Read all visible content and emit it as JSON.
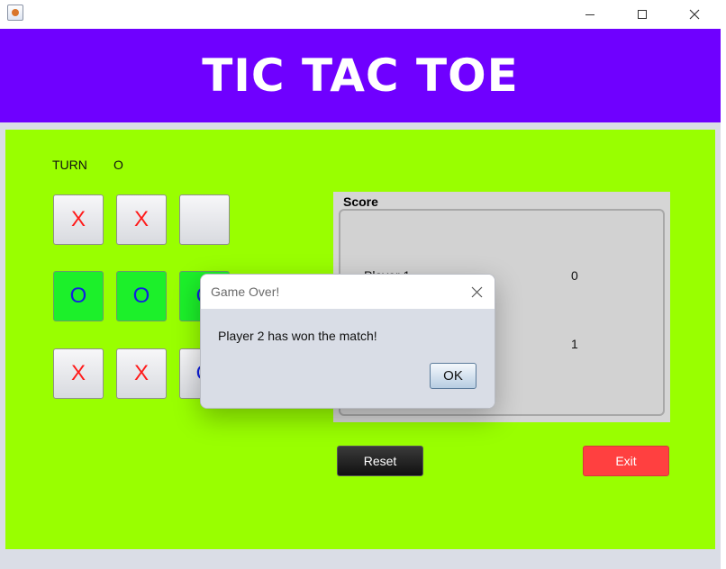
{
  "window": {
    "icon": "java-cup-icon",
    "controls": {
      "minimize": "minimize-icon",
      "maximize": "maximize-icon",
      "close": "close-icon"
    }
  },
  "header": {
    "title": "TIC TAC TOE",
    "background": "#6f00ff"
  },
  "game": {
    "background": "#99ff00",
    "turn_label": "TURN",
    "turn_value": "O",
    "board": [
      [
        "X",
        "X",
        ""
      ],
      [
        "O",
        "O",
        "O"
      ],
      [
        "X",
        "X",
        "O"
      ]
    ],
    "winning_row_color": "#1cf02a"
  },
  "score": {
    "title": "Score",
    "player1_label": "Player 1",
    "player1_score": "0",
    "player2_score": "1"
  },
  "buttons": {
    "reset": "Reset",
    "exit": "Exit",
    "exit_color": "#ff4040"
  },
  "dialog": {
    "title": "Game Over!",
    "message": "Player 2 has won the match!",
    "ok": "OK"
  }
}
